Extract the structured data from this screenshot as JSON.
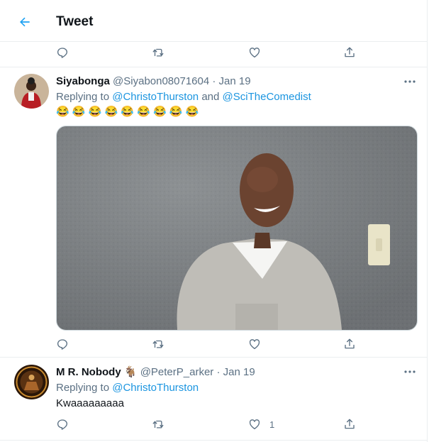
{
  "header": {
    "title": "Tweet"
  },
  "tweets": [
    {
      "display_name": "Siyabonga",
      "handle": "@Siyabon08071604",
      "separator": "·",
      "date": "Jan 19",
      "replying_prefix": "Replying to",
      "mentions": [
        "@ChristoThurston",
        "@SciTheComedist"
      ],
      "conjunction": "and",
      "text": "😂 😂 😂 😂 😂 😂 😂 😂 😂",
      "has_photo": true
    },
    {
      "display_name": "M R. Nobody",
      "name_badge": "🐐",
      "handle": "@PeterP_arker",
      "separator": "·",
      "date": "Jan 19",
      "replying_prefix": "Replying to",
      "mentions": [
        "@ChristoThurston"
      ],
      "text": "Kwaaaaaaaaa",
      "like_count": "1"
    }
  ],
  "icons": {
    "back": "arrow-left-icon",
    "reply": "reply-icon",
    "retweet": "retweet-icon",
    "like": "heart-icon",
    "share": "share-icon",
    "more": "more-dots-icon"
  },
  "colors": {
    "accent": "#1da1f2",
    "link": "#1b95e0",
    "muted": "#5b7083",
    "border": "#ebeef0"
  }
}
